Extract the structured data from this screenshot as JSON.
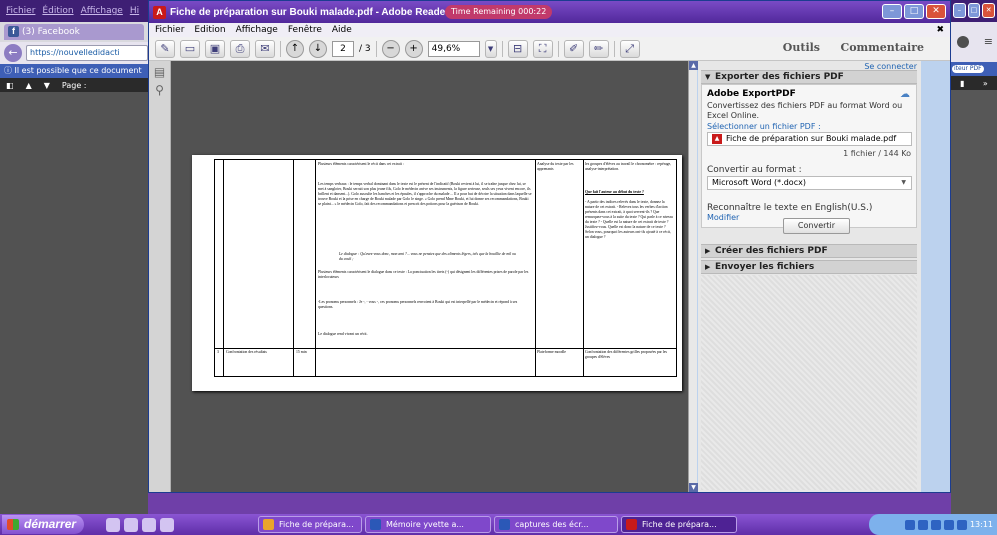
{
  "browser_left": {
    "menu": [
      "Fichier",
      "Édition",
      "Affichage",
      "Hi"
    ],
    "tab_label": "(3) Facebook",
    "url": "https://nouvelledidacti",
    "info_bar": "Il est possible que ce document",
    "pdf_toolbar_page": "Page :"
  },
  "adobe": {
    "title": "Fiche de préparation sur Bouki malade.pdf - Adobe Reader",
    "timer": "Time Remaining 000:22",
    "menu": [
      "Fichier",
      "Edition",
      "Affichage",
      "Fenêtre",
      "Aide"
    ],
    "page_current": "2",
    "page_total": "/ 3",
    "zoom": "49,6%",
    "tab_tools": "Outils",
    "tab_comment": "Commentaire"
  },
  "document": {
    "row1": {
      "col3_intro": "Plusieurs éléments caractérisent le récit dans cet extrait :",
      "col3_body": "Les temps verbaux : le temps verbal dominant dans le texte est le présent de l'indicatif (Bouki revient à lui, il se traîne jusque chez lui, se met à sangloter, Bouki serrait son plus jeune fils, Golo le médecin arrive ses instruments, la figure serieuse, seuls ses yeux vivent encore, ils brillent et dansent...). Golo ausculte les hanches et les épaules, il s'approche du malade ... Il a pour but de décrire la situation dans laquelle se trouve Bouki et la prise en charge de Bouki malade par Golo le singe. « Golo prend Mme Bouki, et lui donne ses recommandations, Bouki se plaint... » le médecin Golo, fait des recommandations et prescrit des potions pour la guérison de Bouki.",
      "col3_quote": "Le dialogue : Qu'avez-vous donc, mon ami ?... vous ne pensiez que des aliments légers, tels que la bouillie de mil ou du couli ;",
      "col3_more": "Plusieurs éléments caractérisent le dialogue dans ce texte : La ponctuation les tirets (-) qui désignent les différentes prises de parole par les interlocuteurs",
      "col3_pron": "-Les pronoms personnels : Je -, - vous -, ces pronoms personnels renvoient à Bouki qui est interpellé par le médecin et répond à ses questions.",
      "col3_end": "Le dialogue rend vivant un récit.",
      "col4": "Analyse du texte par les apprenants",
      "col5_head": "les groupes d'élèves au travail le chronomètre : repérage, analyse-interprétation.",
      "col5_q1": "Que fait l'auteur au début du texte ?",
      "col5_bullets": "- A partir des indices relevés dans le texte, donnez la nature de cet extrait.  - Relevez tous les verbes d'action présents dans cet extrait, à quoi servent-ils ? Que remarquez-vous à la suite du texte ? Qui parle à ce niveau du texte ?  - Quelle est la nature de cet extrait de texte ? Justifiez-vous. Quelle est donc la nature de ce texte ?  Selon vous, pourquoi les auteurs ont-ils ajouté à ce récit, un dialogue ?"
    },
    "row2": {
      "num": "3",
      "col1": "Confrontation des résultats",
      "col2": "15 min",
      "col4": "Plateforme moodle",
      "col5": "Confrontation des différentes grilles proposées par les groupes d'élèves"
    }
  },
  "panel": {
    "sign_in": "Se connecter",
    "export_header": "Exporter des fichiers PDF",
    "export_title": "Adobe ExportPDF",
    "export_desc": "Convertissez des fichiers PDF au format Word ou Excel Online.",
    "select_link": "Sélectionner un fichier PDF :",
    "file_name": "Fiche de préparation sur Bouki malade.pdf",
    "file_count": "1 fichier / 144 Ko",
    "convert_label": "Convertir au format :",
    "format_value": "Microsoft Word (*.docx)",
    "ocr_text": "Reconnaître le texte en English(U.S.)",
    "modify_link": "Modifier",
    "convert_button": "Convertir",
    "create_header": "Créer des fichiers PDF",
    "send_header": "Envoyer les fichiers"
  },
  "browser_right": {
    "pill": "iteur PDF"
  },
  "taskbar": {
    "start": "démarrer",
    "tasks": [
      "Fiche de prépara...",
      "Mémoire yvette a...",
      "captures des écr...",
      "Fiche de prépara..."
    ],
    "clock": "13:11"
  }
}
